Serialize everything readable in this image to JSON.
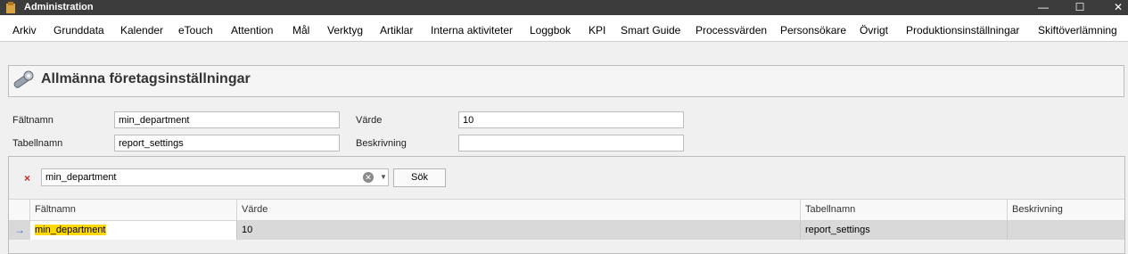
{
  "window": {
    "title": "Administration",
    "minimize": "—",
    "maximize": "☐",
    "close": "✕"
  },
  "menu": [
    "Arkiv",
    "Grunddata",
    "Kalender",
    "eTouch",
    "Attention",
    "Mål",
    "Verktyg",
    "Artiklar",
    "Interna aktiviteter",
    "Loggbok",
    "KPI",
    "Smart Guide",
    "Processvärden",
    "Personsökare",
    "Övrigt",
    "Produktionsinställningar",
    "Skiftöverlämning"
  ],
  "header": {
    "title": "Allmänna företagsinställningar",
    "icon": "wrench-icon"
  },
  "form": {
    "field_name_label": "Fältnamn",
    "field_name_value": "min_department",
    "table_name_label": "Tabellnamn",
    "table_name_value": "report_settings",
    "value_label": "Värde",
    "value_value": "10",
    "description_label": "Beskrivning",
    "description_value": ""
  },
  "filter": {
    "value": "min_department",
    "clear_mark": "×",
    "search_label": "Sök"
  },
  "grid": {
    "columns": [
      "Fältnamn",
      "Värde",
      "Tabellnamn",
      "Beskrivning"
    ],
    "rows": [
      {
        "field": "min_department",
        "value": "10",
        "table": "report_settings",
        "description": ""
      }
    ]
  },
  "colors": {
    "titlebar": "#3c3c3c",
    "highlight": "#ffd800",
    "row_selected": "#d9d9d9"
  }
}
